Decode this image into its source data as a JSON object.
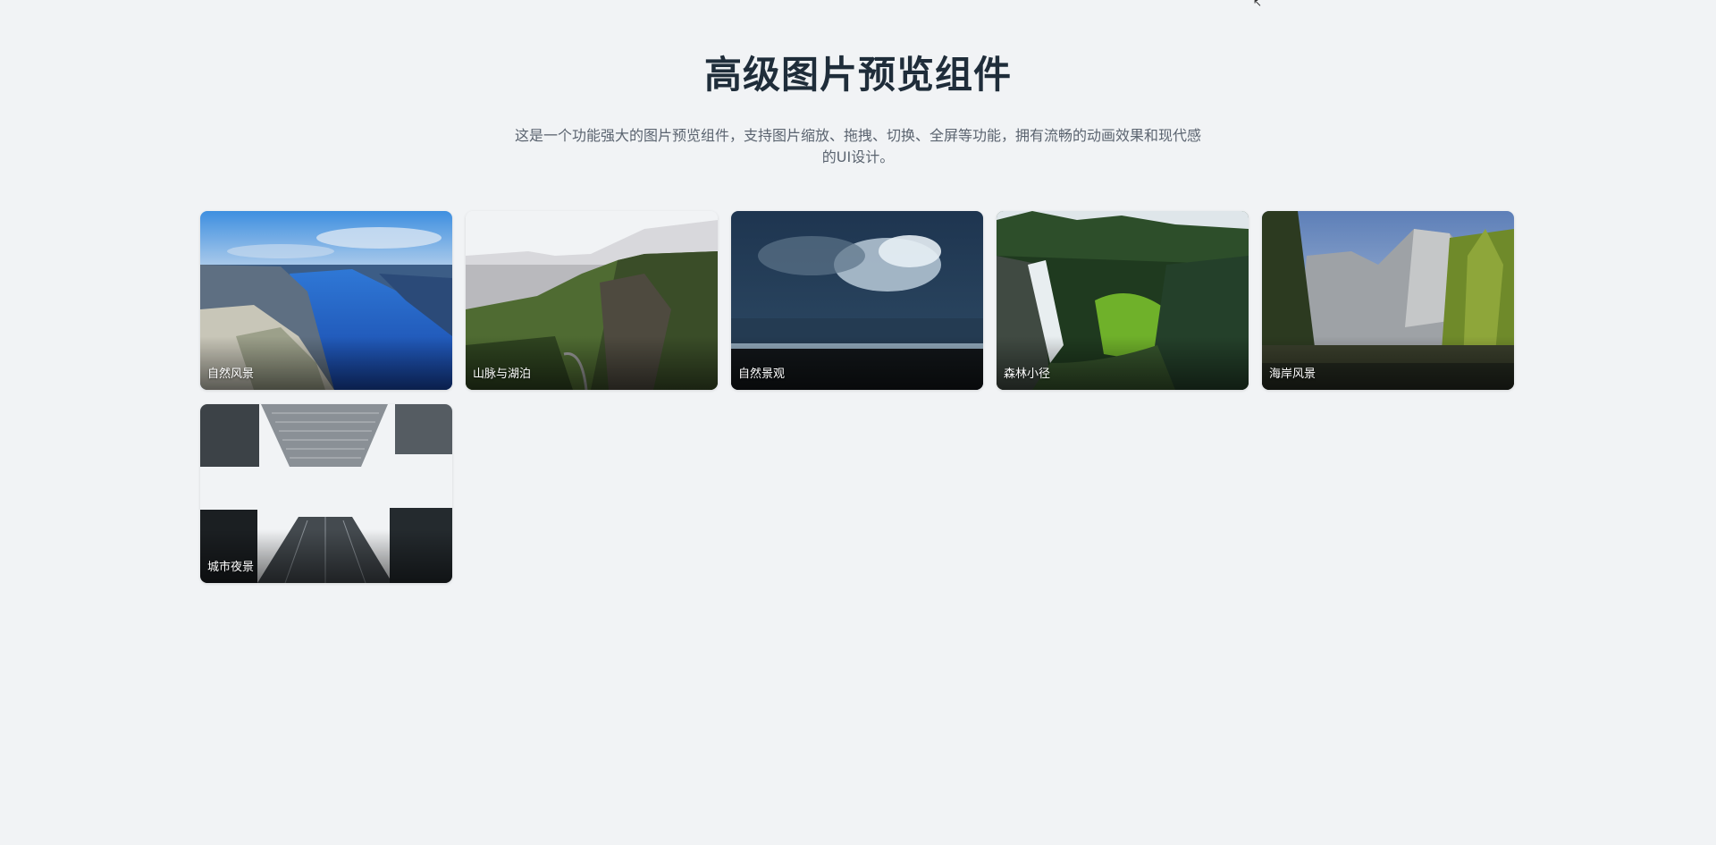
{
  "header": {
    "title": "高级图片预览组件",
    "description_line1": "这是一个功能强大的图片预览组件，支持图片缩放、拖拽、切换、全屏等功能，拥有流畅的动画效果和现代感",
    "description_line2": "的UI设计。"
  },
  "gallery": {
    "items": [
      {
        "label": "自然风景",
        "scene": "fjord"
      },
      {
        "label": "山脉与湖泊",
        "scene": "cliffs"
      },
      {
        "label": "自然景观",
        "scene": "storm"
      },
      {
        "label": "森林小径",
        "scene": "waterfall"
      },
      {
        "label": "海岸风景",
        "scene": "valley"
      },
      {
        "label": "城市夜景",
        "scene": "skyscrapers"
      }
    ]
  },
  "colors": {
    "background": "#f1f3f5",
    "title": "#1f2d3a",
    "description": "#5b6470",
    "caption": "#ffffff"
  }
}
